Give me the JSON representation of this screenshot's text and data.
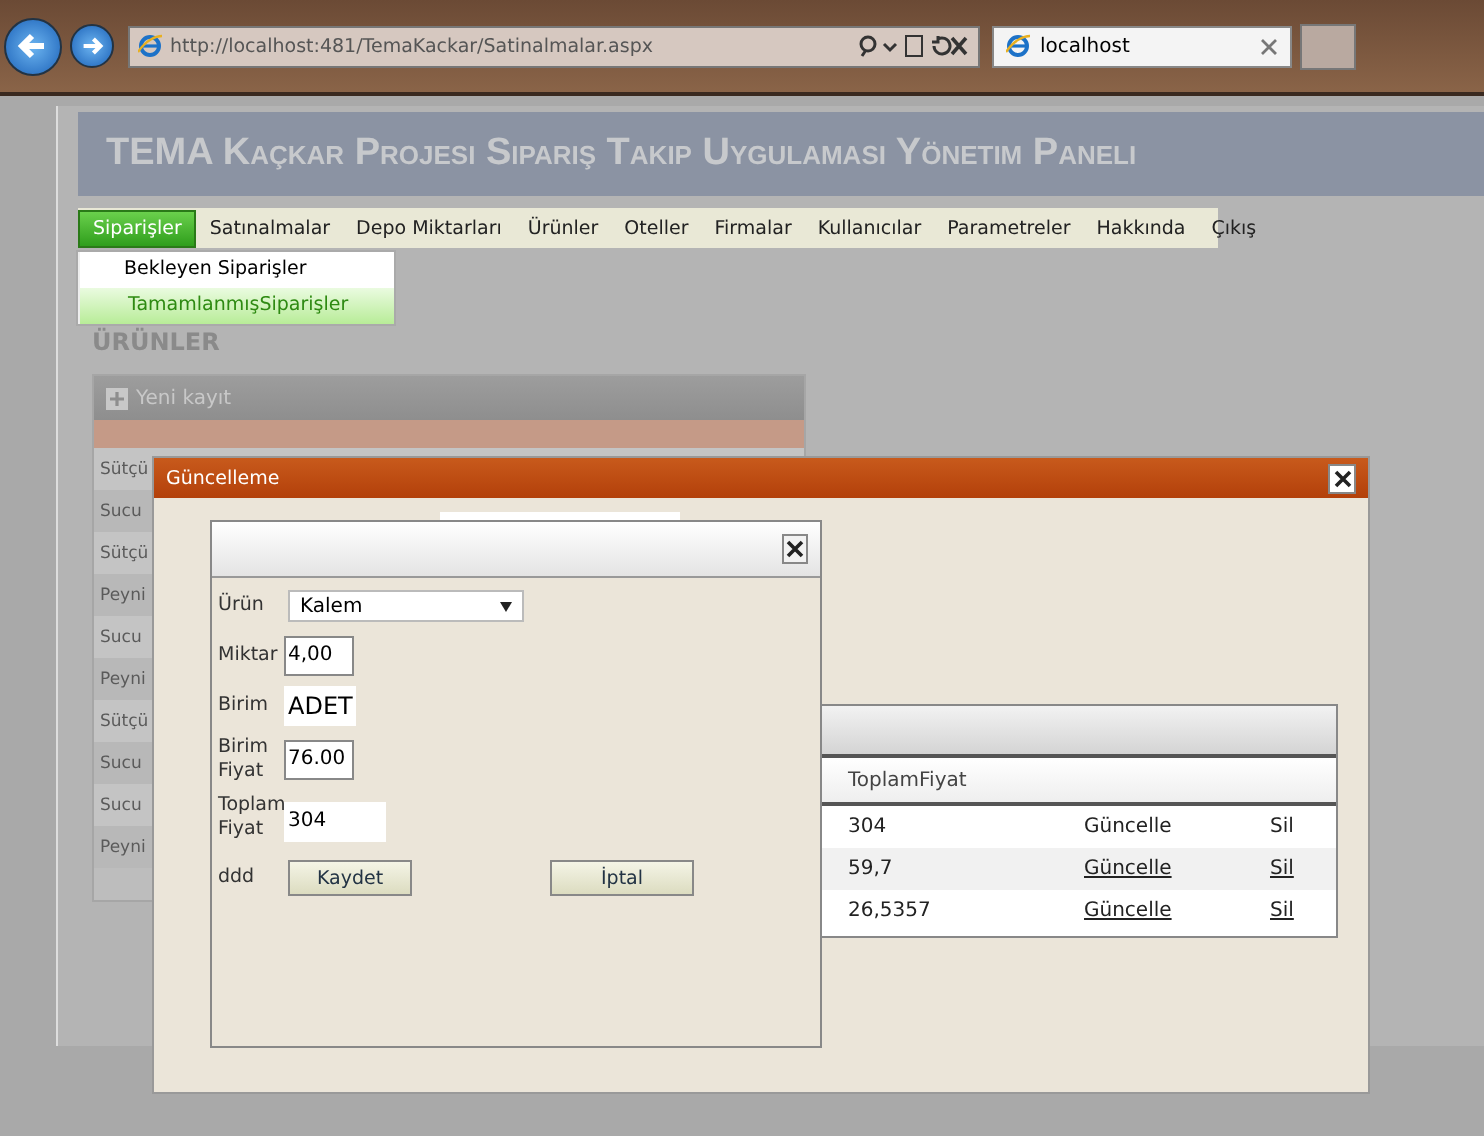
{
  "browser": {
    "address": "http://localhost:481/TemaKackar/Satinalmalar.aspx",
    "tab": "localhost"
  },
  "page": {
    "title": "TEMA Kaçkar Projesi Sipariş Takip Uygulaması Yönetim Paneli",
    "menu": [
      {
        "label": "Siparişler",
        "selected": true
      },
      {
        "label": "Satınalmalar",
        "selected": false
      },
      {
        "label": "Depo Miktarları",
        "selected": false
      },
      {
        "label": "Ürünler",
        "selected": false
      },
      {
        "label": "Oteller",
        "selected": false
      },
      {
        "label": "Firmalar",
        "selected": false
      },
      {
        "label": "Kullanıcılar",
        "selected": false
      },
      {
        "label": "Parametreler",
        "selected": false
      },
      {
        "label": "Hakkında",
        "selected": false
      },
      {
        "label": "Çıkış",
        "selected": false
      }
    ],
    "submenu": [
      {
        "label": "Bekleyen Siparişler",
        "selected": false
      },
      {
        "label": "TamamlanmışSiparişler",
        "selected": true
      }
    ],
    "section": "ÜRÜNLER",
    "grid": {
      "new_record": "Yeni kayıt",
      "rows": [
        "Sütçü",
        "Sucu",
        "Sütçü",
        "Peyni",
        "Sucu",
        "Peyni",
        "Sütçü",
        "Sucu",
        "Sucu",
        "Peyni"
      ]
    }
  },
  "dialog": {
    "title": "Güncelleme",
    "table": {
      "column": "ToplamFiyat",
      "rows": [
        {
          "total": "304",
          "edit": "Güncelle",
          "delete": "Sil",
          "editing": true
        },
        {
          "total": "59,7",
          "edit": "Güncelle",
          "delete": "Sil",
          "editing": false
        },
        {
          "total": "26,5357",
          "edit": "Güncelle",
          "delete": "Sil",
          "editing": false
        }
      ]
    }
  },
  "edit_form": {
    "fields": [
      {
        "kind": "select",
        "label": "Ürün",
        "value": "Kalem"
      },
      {
        "kind": "text",
        "label": "Miktar",
        "value": "4,00"
      },
      {
        "kind": "big",
        "label": "Birim",
        "value": "ADET"
      },
      {
        "kind": "text",
        "label": "Birim Fiyat",
        "value": "76.00"
      },
      {
        "kind": "wide",
        "label": "Toplam Fiyat",
        "value": "304"
      }
    ],
    "footer_label": "ddd",
    "save": "Kaydet",
    "cancel": "İptal"
  }
}
